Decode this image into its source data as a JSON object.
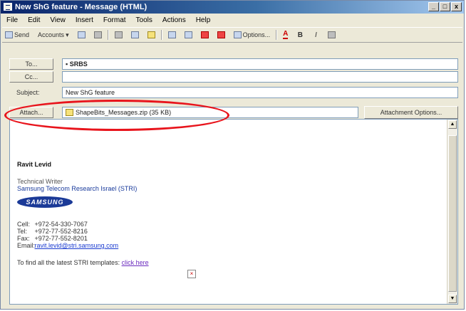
{
  "window": {
    "title": "New ShG feature - Message (HTML)",
    "controls": [
      "_",
      "□",
      "x"
    ]
  },
  "menu": [
    "File",
    "Edit",
    "View",
    "Insert",
    "Format",
    "Tools",
    "Actions",
    "Help"
  ],
  "toolbar": {
    "send_label": "Send",
    "accounts_label": "Accounts",
    "options_label": "Options..."
  },
  "header": {
    "to_label": "To...",
    "to_value": "SRBS",
    "cc_label": "Cc...",
    "cc_value": "",
    "subject_label": "Subject:",
    "subject_value": "New ShG feature",
    "attach_label": "Attach...",
    "attach_value": "ShapeBits_Messages.zip (35 KB)",
    "attachment_options_label": "Attachment Options..."
  },
  "signature": {
    "name": "Ravit Levid",
    "title": "Technical Writer",
    "organization": "Samsung Telecom Research Israel (STRI)",
    "logo_text": "SAMSUNG",
    "cell_label": "Cell:",
    "cell_value": "+972-54-330-7067",
    "tel_label": "Tel:",
    "tel_value": "+972-77-552-8216",
    "fax_label": "Fax:",
    "fax_value": "+972-77-552-8201",
    "email_label": "Email:",
    "email_value": "ravit.levid@stri.samsung.com",
    "templates_text": "To find all the latest STRI templates:",
    "templates_link": "click here"
  },
  "colors": {
    "annotation": "#e8141c",
    "titlebar": "#0a246a"
  }
}
